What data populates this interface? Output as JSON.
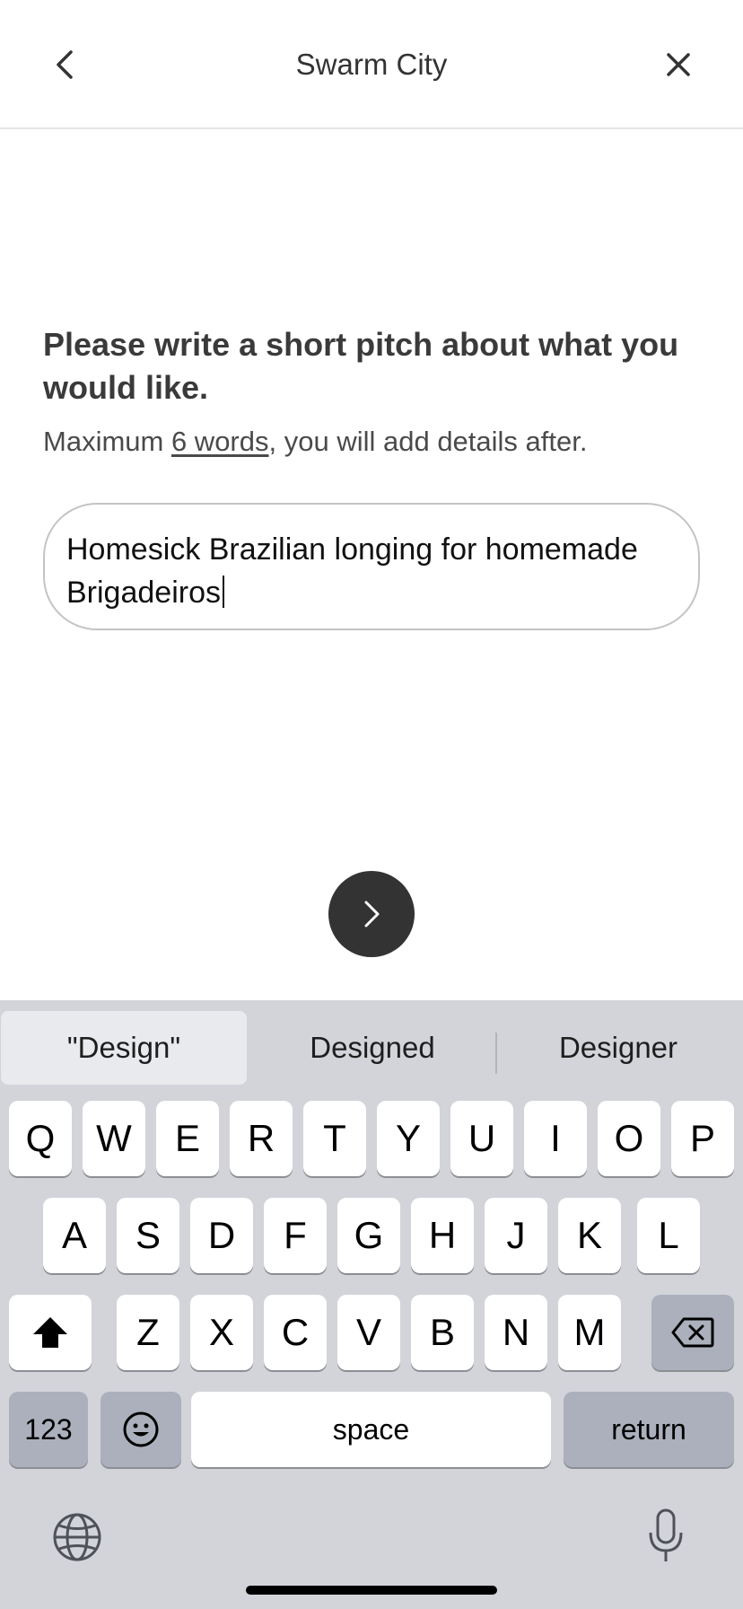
{
  "header": {
    "title": "Swarm City"
  },
  "prompt": {
    "heading": "Please write a short pitch about what you would like.",
    "sub_prefix": "Maximum ",
    "sub_link": "6 words",
    "sub_suffix": ", you will add details after."
  },
  "pitch_input": {
    "value": "Homesick Brazilian longing for homemade Brigadeiros"
  },
  "keyboard": {
    "suggestions": [
      "\"Design\"",
      "Designed",
      "Designer"
    ],
    "row1": [
      "Q",
      "W",
      "E",
      "R",
      "T",
      "Y",
      "U",
      "I",
      "O",
      "P"
    ],
    "row2": [
      "A",
      "S",
      "D",
      "F",
      "G",
      "H",
      "J",
      "K",
      "L"
    ],
    "row3": [
      "Z",
      "X",
      "C",
      "V",
      "B",
      "N",
      "M"
    ],
    "numbers_label": "123",
    "space_label": "space",
    "return_label": "return"
  },
  "icons": {
    "back": "chevron-left-icon",
    "close": "close-icon",
    "next": "chevron-right-icon",
    "shift": "shift-icon",
    "delete": "backspace-icon",
    "emoji": "emoji-icon",
    "globe": "globe-icon",
    "mic": "microphone-icon"
  },
  "colors": {
    "accent": "#333333",
    "keyboard_bg": "#d2d4da"
  }
}
